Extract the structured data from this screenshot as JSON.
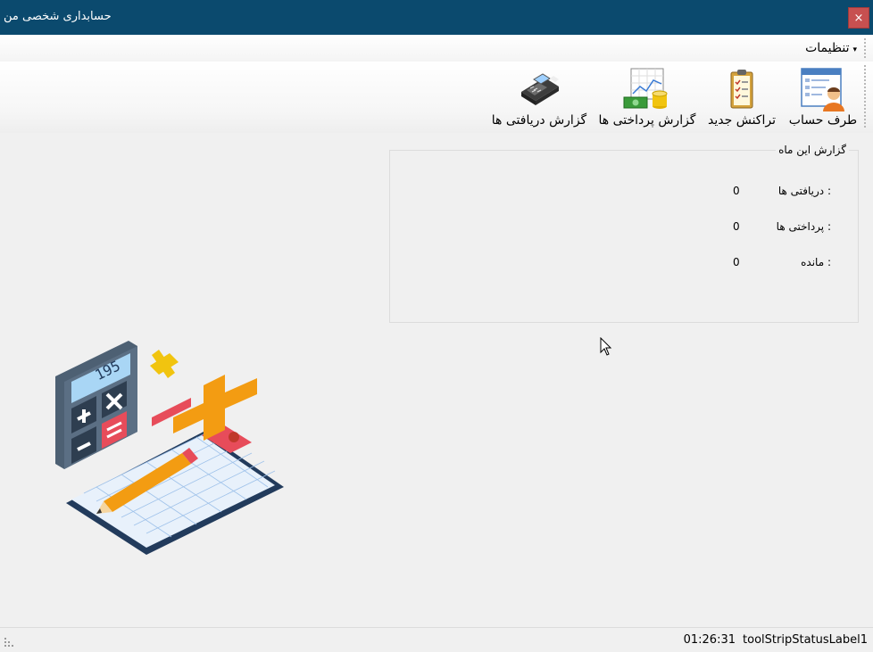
{
  "window": {
    "title": "حسابداری شخصی من",
    "close_label": "×"
  },
  "menu": {
    "settings_label": "تنظیمات",
    "caret": "▾"
  },
  "toolbar": {
    "items": [
      {
        "label": "طرف حساب",
        "icon": "account-person-icon"
      },
      {
        "label": "تراکنش جدید",
        "icon": "clipboard-icon"
      },
      {
        "label": "گزارش پرداختی ها",
        "icon": "money-chart-icon"
      },
      {
        "label": "گزارش دریافتی ها",
        "icon": "pos-terminal-icon"
      }
    ]
  },
  "report": {
    "title": "گزارش این ماه",
    "received_label": "دریافتی ها :",
    "received_value": "0",
    "paid_label": "پرداختی ها :",
    "paid_value": "0",
    "balance_label": "مانده :",
    "balance_value": "0"
  },
  "status": {
    "label": "toolStripStatusLabel1",
    "time": "01:26:31"
  },
  "illustration": {
    "display_text": "195",
    "icon": "calculator-illustration"
  }
}
